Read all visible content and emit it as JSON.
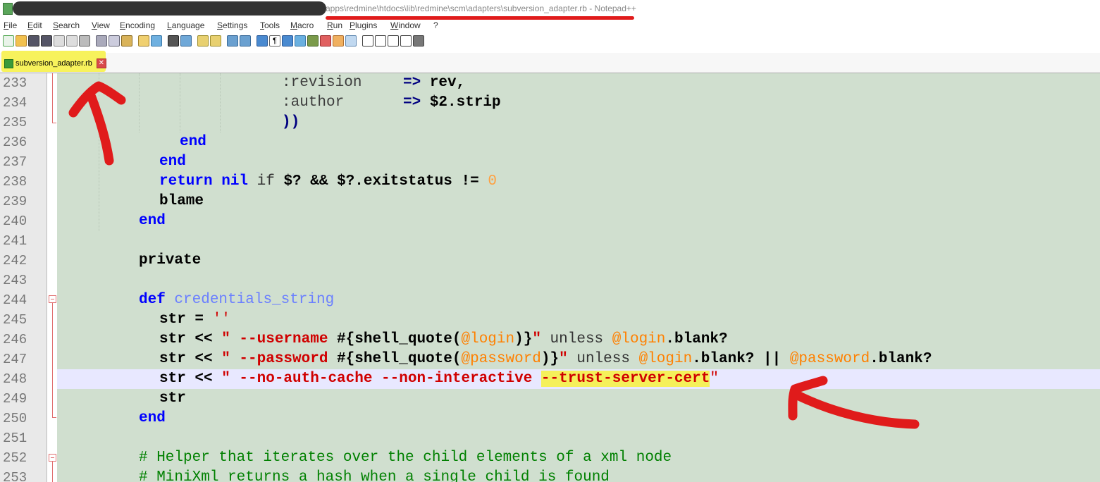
{
  "window": {
    "title": "apps\\redmine\\htdocs\\lib\\redmine\\scm\\adapters\\subversion_adapter.rb - Notepad++"
  },
  "menu": {
    "items": [
      "File",
      "Edit",
      "Search",
      "View",
      "Encoding",
      "Language",
      "Settings",
      "Tools",
      "Macro",
      "Run",
      "Plugins",
      "Window",
      "?"
    ]
  },
  "tabs": [
    {
      "label": "subversion_adapter.rb",
      "close_glyph": "✕"
    }
  ],
  "editor": {
    "lines": [
      {
        "n": "233"
      },
      {
        "n": "234"
      },
      {
        "n": "235"
      },
      {
        "n": "236"
      },
      {
        "n": "237"
      },
      {
        "n": "238"
      },
      {
        "n": "239"
      },
      {
        "n": "240"
      },
      {
        "n": "241"
      },
      {
        "n": "242"
      },
      {
        "n": "243"
      },
      {
        "n": "244"
      },
      {
        "n": "245"
      },
      {
        "n": "246"
      },
      {
        "n": "247"
      },
      {
        "n": "248"
      },
      {
        "n": "249"
      },
      {
        "n": "250"
      },
      {
        "n": "251"
      },
      {
        "n": "252"
      },
      {
        "n": "253"
      }
    ],
    "tokens": {
      "l233_sym": ":revision",
      "l233_op": "=> ",
      "l233_v": "rev,",
      "l234_sym": ":author",
      "l234_op": "=> ",
      "l234_v": "$2.strip",
      "l235_v": "))",
      "l236_v": "end",
      "l237_v": "end",
      "l238_kw": "return nil",
      "l238_if": " if ",
      "l238_v": "$? && $?.exitstatus != ",
      "l238_num": "0",
      "l239_v": "blame",
      "l240_v": "end",
      "l242_v": "private",
      "l244_kw": "def ",
      "l244_name": "credentials_string",
      "l245_v": "str = ",
      "l245_s": "''",
      "l246_a": "str << ",
      "l246_s1": "\" --username ",
      "l246_b": "#{shell_quote(",
      "l246_iv": "@login",
      "l246_c": ")}",
      "l246_s2": "\"",
      "l246_un": " unless ",
      "l246_iv2": "@login",
      "l246_d": ".blank?",
      "l247_a": "str << ",
      "l247_s1": "\" --password ",
      "l247_b": "#{shell_quote(",
      "l247_iv": "@password",
      "l247_c": ")}",
      "l247_s2": "\"",
      "l247_un": " unless ",
      "l247_iv2": "@login",
      "l247_d": ".blank? || ",
      "l247_iv3": "@password",
      "l247_e": ".blank?",
      "l248_a": "str << ",
      "l248_s1": "\" --no-auth-cache --non-interactive ",
      "l248_hl": "--trust-server-cert",
      "l248_s2": "\"",
      "l249_v": "str",
      "l250_v": "end",
      "l252_c": "# Helper that iterates over the child elements of a xml node",
      "l253_c": "# MiniXml returns a hash when a single child is found"
    }
  },
  "colors": {
    "annotation": "#e01b1b",
    "highlight": "#f5f05a",
    "code_bg": "#d0dfcf",
    "current_line": "#e8e8ff"
  }
}
